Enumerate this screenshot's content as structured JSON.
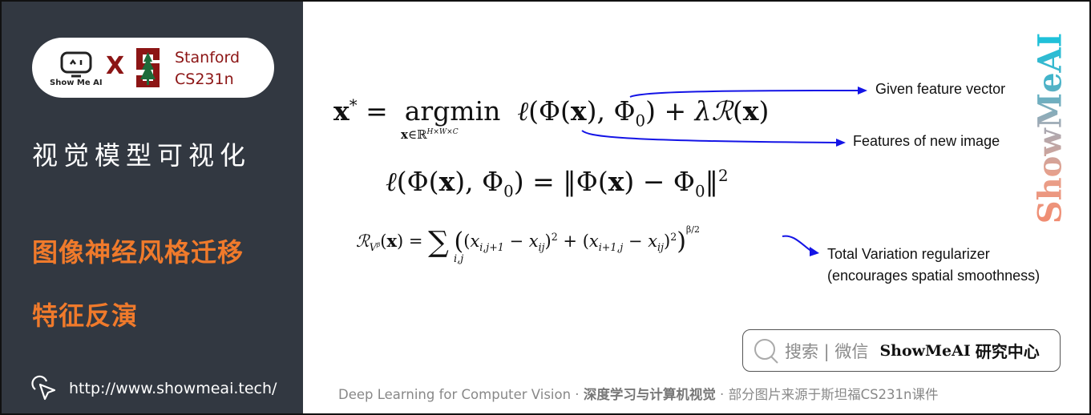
{
  "sidebar": {
    "logo": {
      "showmeai_label": "Show Me AI",
      "separator": "X",
      "partner_line1": "Stanford",
      "partner_line2": "CS231n"
    },
    "course_title": "视觉模型可视化",
    "topics": [
      "图像神经风格迁移",
      "特征反演"
    ],
    "url": "http://www.showmeai.tech/",
    "url_icon": "cursor-click-icon"
  },
  "slide": {
    "equations": {
      "objective": {
        "lhs": "x* =",
        "operator": "argmin",
        "constraint": "x∈ℝ^{H×W×C}",
        "rhs": "ℓ(Φ(x), Φ₀) + λℛ(x)"
      },
      "loss": "ℓ(Φ(x), Φ₀) = ‖Φ(x) − Φ₀‖²",
      "regularizer": {
        "lhs": "ℛ_{V^β}(x) =",
        "sum_index": "i,j",
        "body": "((x_{i,j+1} − x_{ij})² + (x_{i+1,j} − x_{ij})²)^{β/2}"
      }
    },
    "annotations": [
      "Given feature vector",
      "Features of new image",
      "Total Variation regularizer",
      "(encourages spatial smoothness)"
    ],
    "watermark": "ShowMeAI",
    "arrow_color": "#1414e6"
  },
  "search_box": {
    "icon": "search-icon",
    "label": "搜索 | 微信",
    "brand": "ShowMeAI",
    "brand_cn": "研究中心"
  },
  "footer": {
    "en": "Deep Learning for Computer Vision",
    "sep1": " · ",
    "cn": "深度学习与计算机视觉",
    "sep2": " · ",
    "credit": "部分图片来源于斯坦福CS231n课件"
  },
  "colors": {
    "sidebar_bg": "#323841",
    "accent_orange": "#f07a2b",
    "stanford_red": "#8c1515",
    "arrow_blue": "#1414e6"
  }
}
